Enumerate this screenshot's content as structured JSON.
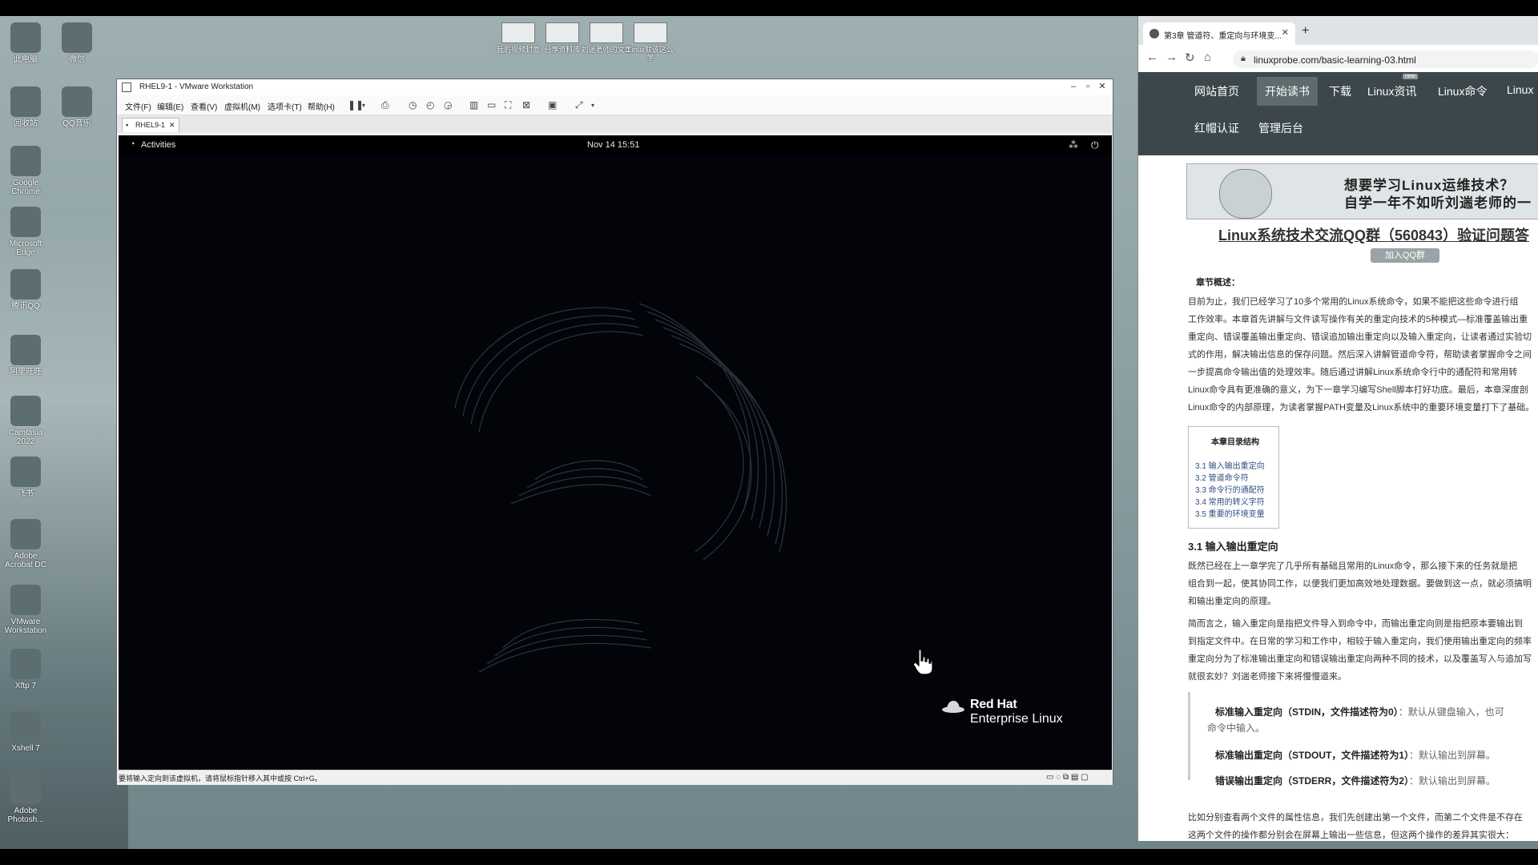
{
  "desktop": {
    "left_icons": [
      {
        "label": "此电脑",
        "icon": "computer-icon"
      },
      {
        "label": "微信",
        "icon": "wechat-icon"
      },
      {
        "label": "回收站",
        "icon": "recycle-bin-icon"
      },
      {
        "label": "QQ音乐",
        "icon": "music-icon"
      },
      {
        "label": "Google Chrome",
        "icon": "chrome-icon"
      },
      {
        "label": "Microsoft Edge",
        "icon": "edge-icon"
      },
      {
        "label": "腾讯QQ",
        "icon": "qq-icon"
      },
      {
        "label": "阿里旺旺",
        "icon": "aliwangwang-icon"
      },
      {
        "label": "Camtasia 2022",
        "icon": "camtasia-icon"
      },
      {
        "label": "飞书",
        "icon": "feishu-icon"
      },
      {
        "label": "Adobe Acrobat DC",
        "icon": "acrobat-icon"
      },
      {
        "label": "VMware Workstation",
        "icon": "vmware-icon"
      },
      {
        "label": "Xftp 7",
        "icon": "xftp-icon"
      },
      {
        "label": "Xshell 7",
        "icon": "xshell-icon"
      },
      {
        "label": "Adobe Photosh...",
        "icon": "photoshop-icon"
      }
    ],
    "top_icons": [
      {
        "label": "我的视频封面"
      },
      {
        "label": "分享资料库"
      },
      {
        "label": "刘遄老师的文章"
      },
      {
        "label": "Linux就该这么学"
      }
    ]
  },
  "vmware": {
    "title": "RHEL9-1 - VMware Workstation",
    "menu": [
      "文件(F)",
      "编辑(E)",
      "查看(V)",
      "虚拟机(M)",
      "选项卡(T)",
      "帮助(H)"
    ],
    "tab": "RHEL9-1",
    "status": "要将输入定向到该虚拟机，请将鼠标指针移入其中或按 Ctrl+G。"
  },
  "guest": {
    "activities": "Activities",
    "clock": "Nov 14  15:51",
    "logo_line1": "Red Hat",
    "logo_line2": "Enterprise Linux"
  },
  "browser": {
    "tab_title": "第3章 管道符、重定向与环境变...",
    "url": "linuxprobe.com/basic-learning-03.html",
    "nav": [
      "网站首页",
      "开始读书",
      "下载",
      "Linux资讯",
      "Linux命令",
      "Linux"
    ],
    "nav2": [
      "红帽认证",
      "管理后台"
    ],
    "nav_badge": "new",
    "banner_line1": "想要学习Linux运维技术？",
    "banner_line2": "自学一年不如听刘遄老师的一",
    "qq_group": "Linux系统技术交流QQ群（560843）验证问题答",
    "qq_button": "加入QQ群",
    "summary_heading": "章节概述：",
    "summary_lines": [
      "目前为止，我们已经学习了10多个常用的Linux系统命令，如果不能把这些命令进行组",
      "工作效率。本章首先讲解与文件读写操作有关的重定向技术的5种模式—标准覆盖输出重",
      "重定向、错误覆盖输出重定向、错误追加输出重定向以及输入重定向，让读者通过实验切",
      "式的作用，解决输出信息的保存问题。然后深入讲解管道命令符，帮助读者掌握命令之间",
      "一步提高命令输出值的处理效率。随后通过讲解Linux系统命令行中的通配符和常用转",
      "Linux命令具有更准确的意义，为下一章学习编写Shell脚本打好功底。最后，本章深度剖",
      "Linux命令的内部原理，为读者掌握PATH变量及Linux系统中的重要环境变量打下了基础。"
    ],
    "toc_title": "本章目录结构",
    "toc": [
      "3.1 输入输出重定向",
      "3.2 管道命令符",
      "3.3 命令行的通配符",
      "3.4 常用的转义字符",
      "3.5 重要的环境变量"
    ],
    "section_title": "3.1 输入输出重定向",
    "sec_lines": [
      "既然已经在上一章学完了几乎所有基础且常用的Linux命令，那么接下来的任务就是把",
      "组合到一起，使其协同工作，以便我们更加高效地处理数据。要做到这一点，就必须搞明",
      "和输出重定向的原理。"
    ],
    "sec_lines2": [
      "简而言之，输入重定向是指把文件导入到命令中，而输出重定向则是指把原本要输出到",
      "到指定文件中。在日常的学习和工作中，相较于输入重定向，我们使用输出重定向的频率",
      "重定向分为了标准输出重定向和错误输出重定向两种不同的技术，以及覆盖写入与追加写",
      "就很玄妙？刘遄老师接下来将慢慢道来。"
    ],
    "stdin_label": "标准输入重定向（STDIN，文件描述符为0）",
    "stdin_desc": "：默认从键盘输入，也可",
    "stdin_desc2": "命令中输入。",
    "stdout_label": "标准输出重定向（STDOUT，文件描述符为1）",
    "stdout_desc": "：默认输出到屏幕。",
    "stderr_label": "错误输出重定向（STDERR，文件描述符为2）",
    "stderr_desc": "：默认输出到屏幕。",
    "tail_lines": [
      "比如分别查看两个文件的属性信息，我们先创建出第一个文件，而第二个文件是不存在",
      "这两个文件的操作都分别会在屏幕上输出一些信息，但这两个操作的差异其实很大："
    ]
  }
}
